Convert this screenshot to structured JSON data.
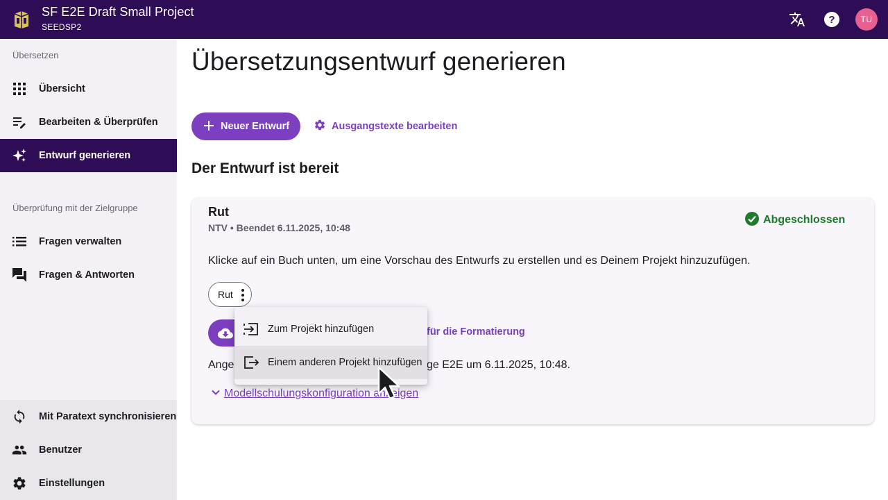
{
  "header": {
    "project_title": "SF E2E Draft Small Project",
    "project_code": "SEEDSP2",
    "avatar_initials": "TU",
    "icons": [
      "translate-icon",
      "help-icon"
    ]
  },
  "sidebar": {
    "section_translate": "Übersetzen",
    "items_translate": [
      {
        "label": "Übersicht",
        "icon": "grid-icon"
      },
      {
        "label": "Bearbeiten & Überprüfen",
        "icon": "edit-notes-icon"
      },
      {
        "label": "Entwurf generieren",
        "icon": "sparkle-icon",
        "active": true
      }
    ],
    "section_community": "Überprüfung mit der Zielgruppe",
    "items_community": [
      {
        "label": "Fragen verwalten",
        "icon": "list-icon"
      },
      {
        "label": "Fragen & Antworten",
        "icon": "forum-icon"
      }
    ],
    "items_bottom": [
      {
        "label": "Mit Paratext synchronisieren",
        "icon": "sync-icon"
      },
      {
        "label": "Benutzer",
        "icon": "people-icon"
      },
      {
        "label": "Einstellungen",
        "icon": "gear-icon"
      }
    ]
  },
  "main": {
    "page_title": "Übersetzungsentwurf generieren",
    "new_draft_label": "Neuer Entwurf",
    "edit_sources_label": "Ausgangstexte bearbeiten",
    "section_title": "Der Entwurf ist bereit",
    "card": {
      "book_title": "Rut",
      "meta": "NTV • Beendet 6.11.2025, 10:48",
      "status": "Abgeschlossen",
      "description": "Klicke auf ein Buch unten, um eine Vorschau des Entwurfs zu erstellen und es Deinem Projekt hinzuzufügen.",
      "book_chip": "Rut",
      "format_link_partial": "für die Formatierung",
      "applied_partial": "Ange",
      "applied_tail": "ge E2E um 6.11.2025, 10:48.",
      "config_link": "Modellschulungskonfiguration anzeigen"
    }
  },
  "menu": {
    "items": [
      {
        "label": "Zum Projekt hinzufügen",
        "icon": "input-icon"
      },
      {
        "label": "Einem anderen Projekt hinzufügen",
        "icon": "output-icon",
        "hover": true
      }
    ]
  },
  "colors": {
    "brand_dark": "#2e0c56",
    "accent": "#7b3fbf",
    "success": "#1f7a2c",
    "avatar": "#e8608f"
  }
}
